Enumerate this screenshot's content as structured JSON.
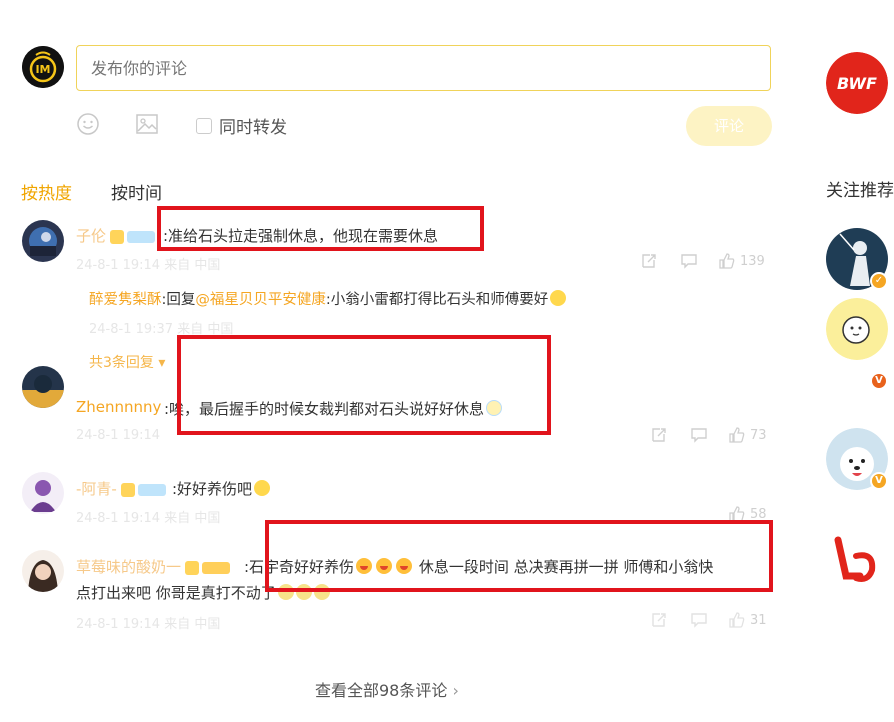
{
  "composer": {
    "placeholder": "发布你的评论",
    "repost_label": "同时转发",
    "submit_label": "评论"
  },
  "tabs": [
    {
      "label": "按热度",
      "active": true
    },
    {
      "label": "按时间",
      "active": false
    }
  ],
  "comments": [
    {
      "name": "子伦",
      "text": ":准给石头拉走强制休息，他现在需要休息",
      "meta": "24-8-1 19:14  来自 中国",
      "likes": "139",
      "reply": {
        "name": "醉爱隽梨酥",
        "prefix": ":回复",
        "mention": "@福星贝贝平安健康",
        "text": ":小翁小雷都打得比石头和师傅要好",
        "meta": "24-8-1 19:37  来自 中国"
      },
      "more_replies": "共3条回复"
    },
    {
      "name": "Zhennnnny",
      "text": ":唉，最后握手的时候女裁判都对石头说好好休息",
      "meta": "24-8-1 19:14",
      "likes": "73"
    },
    {
      "name": "-阿青-",
      "text": ":好好养伤吧",
      "meta": "24-8-1 19:14  来自 中国",
      "likes": "58"
    },
    {
      "name": "草莓味的酸奶一",
      "text_line1_a": ":石宇奇好好养伤",
      "text_line1_b": "休息一段时间  总决赛再拼一拼  师傅和小翁快",
      "text_line2": "点打出来吧 你哥是真打不动了",
      "meta": "24-8-1 19:14  来自 中国",
      "likes": "31"
    }
  ],
  "view_all": "查看全部98条评论",
  "sidebar": {
    "follow_title": "关注推荐",
    "bwf_logo_text": "BWF"
  },
  "colors": {
    "accent": "#f5a623",
    "highlight": "#e1141c",
    "input_border": "#f0d35a"
  }
}
